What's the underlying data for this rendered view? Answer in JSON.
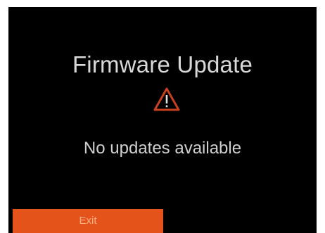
{
  "screen": {
    "title": "Firmware Update",
    "message": "No updates available",
    "warning_icon": "warning-triangle-icon",
    "exit_label": "Exit"
  },
  "colors": {
    "background": "#000000",
    "accent": "#e4531a",
    "warning": "#c8401e",
    "text": "#d8d8d8"
  }
}
